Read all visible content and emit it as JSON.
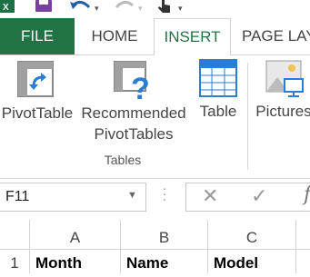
{
  "quick_access": {
    "icons": [
      "excel-logo-icon",
      "save-icon",
      "undo-icon",
      "redo-icon",
      "touch-mode-icon",
      "customize-dropdown-icon"
    ]
  },
  "tabs": [
    {
      "label": "FILE"
    },
    {
      "label": "HOME"
    },
    {
      "label": "INSERT"
    },
    {
      "label": "PAGE LAY"
    }
  ],
  "ribbon": {
    "buttons": [
      {
        "line1": "PivotTable",
        "line2": ""
      },
      {
        "line1": "Recommended",
        "line2": "PivotTables"
      },
      {
        "line1": "Table",
        "line2": ""
      },
      {
        "line1": "Pictures",
        "line2": ""
      }
    ],
    "group_label": "Tables"
  },
  "formula_bar": {
    "name_box": "F11",
    "fx": "f"
  },
  "columns": [
    "A",
    "B",
    "C"
  ],
  "rows": [
    {
      "number": "1",
      "cells": [
        "Month",
        "Name",
        "Model"
      ]
    }
  ],
  "colors": {
    "file_tab": "#217346",
    "active_tab_text": "#217346",
    "pivot_blue": "#2b7cd3"
  }
}
